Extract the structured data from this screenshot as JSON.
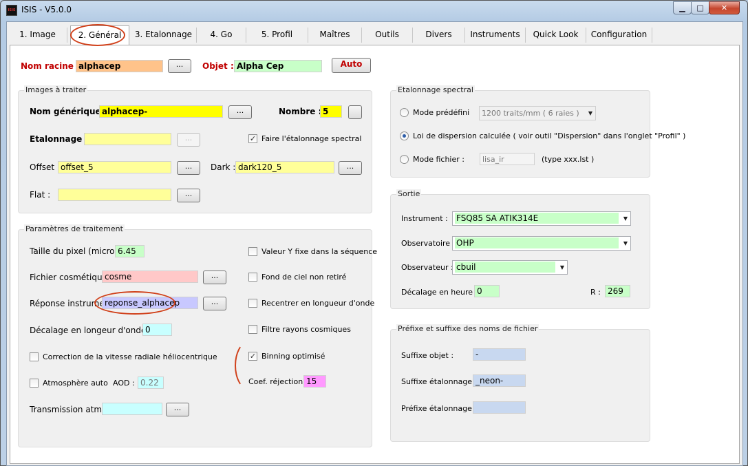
{
  "window": {
    "title": "ISIS - V5.0.0",
    "icon_text": "ISIS"
  },
  "tabs": [
    {
      "label": "1. Image"
    },
    {
      "label": "2. Général"
    },
    {
      "label": "3. Etalonnage"
    },
    {
      "label": "4. Go"
    },
    {
      "label": "5. Profil"
    },
    {
      "label": "Maîtres"
    },
    {
      "label": "Outils"
    },
    {
      "label": "Divers"
    },
    {
      "label": "Instruments"
    },
    {
      "label": "Quick Look"
    },
    {
      "label": "Configuration"
    }
  ],
  "top": {
    "nom_racine_label": "Nom racine :",
    "nom_racine_value": "alphacep",
    "browse": "...",
    "objet_label": "Objet :",
    "objet_value": "Alpha Cep",
    "auto_label": "Auto"
  },
  "images": {
    "title": "Images à traiter",
    "nom_generique_label": "Nom générique :",
    "nom_generique_value": "alphacep-",
    "nombre_label": "Nombre :",
    "nombre_value": "5",
    "etalonnage_label": "Etalonnage :",
    "etalonnage_value": "",
    "faire_etalonnage_label": "Faire l'étalonnage spectral",
    "faire_etalonnage_checked": true,
    "offset_label": "Offset :",
    "offset_value": "offset_5",
    "dark_label": "Dark :",
    "dark_value": "dark120_5",
    "flat_label": "Flat :",
    "flat_value": ""
  },
  "params": {
    "title": "Paramètres de traitement",
    "pixel_label": "Taille du pixel (microns) :",
    "pixel_value": "6.45",
    "cosmetique_label": "Fichier cosmétique :",
    "cosmetique_value": "cosme",
    "reponse_label": "Réponse instrument :",
    "reponse_value": "reponse_alphacep",
    "decalage_label": "Décalage en longeur d'onde (A) :",
    "decalage_value": "0",
    "correction_label": "Correction de la vitesse radiale héliocentrique",
    "atmosphere_label": "Atmosphère auto",
    "aod_label": "AOD :",
    "aod_value": "0.22",
    "transmission_label": "Transmission atmo. :",
    "transmission_value": "",
    "valeur_y_label": "Valeur Y fixe dans la séquence",
    "fond_label": "Fond de ciel non retiré",
    "recentrer_label": "Recentrer en longueur d'onde",
    "filtre_label": "Filtre rayons cosmiques",
    "binning_label": "Binning optimisé",
    "binning_checked": true,
    "coef_label": "Coef. réjection :",
    "coef_value": "15"
  },
  "etalonnage": {
    "title": "Etalonnage spectral",
    "mode_predefini_label": "Mode prédéfini",
    "mode_predefini_value": "1200 traits/mm ( 6 raies )",
    "loi_label": "Loi de dispersion calculée ( voir outil \"Dispersion\" dans l'onglet \"Profil\" )",
    "mode_fichier_label": "Mode fichier :",
    "mode_fichier_value": "lisa_ir",
    "type_label": "(type xxx.lst )",
    "selected": "loi"
  },
  "sortie": {
    "title": "Sortie",
    "instrument_label": "Instrument :",
    "instrument_value": "FSQ85 SA ATIK314E",
    "observatoire_label": "Observatoire :",
    "observatoire_value": "OHP",
    "observateur_label": "Observateur :",
    "observateur_value": "cbuil",
    "decalage_label": "Décalage en heure :",
    "decalage_value": "0",
    "r_label": "R :",
    "r_value": "269"
  },
  "prefixe": {
    "title": "Préfixe et suffixe des noms de fichier",
    "suffixe_objet_label": "Suffixe objet :",
    "suffixe_objet_value": "-",
    "suffixe_etal_label": "Suffixe étalonnage :",
    "suffixe_etal_value": "_neon-",
    "prefixe_etal_label": "Préfixe étalonnage :",
    "prefixe_etal_value": ""
  },
  "colors": {
    "orange_field": "#ffc38a",
    "green_field": "#c8ffc8",
    "yellow_field": "#ffff00",
    "pale_yellow_field": "#ffff99",
    "pink_field": "#ffc8c8",
    "lavender_field": "#c8c8ff",
    "cyan_field": "#c8ffff",
    "light_blue_field": "#c8d8f0",
    "magenta_field": "#ff99ff",
    "annotation": "#d0401a",
    "label_red": "#c00000"
  }
}
